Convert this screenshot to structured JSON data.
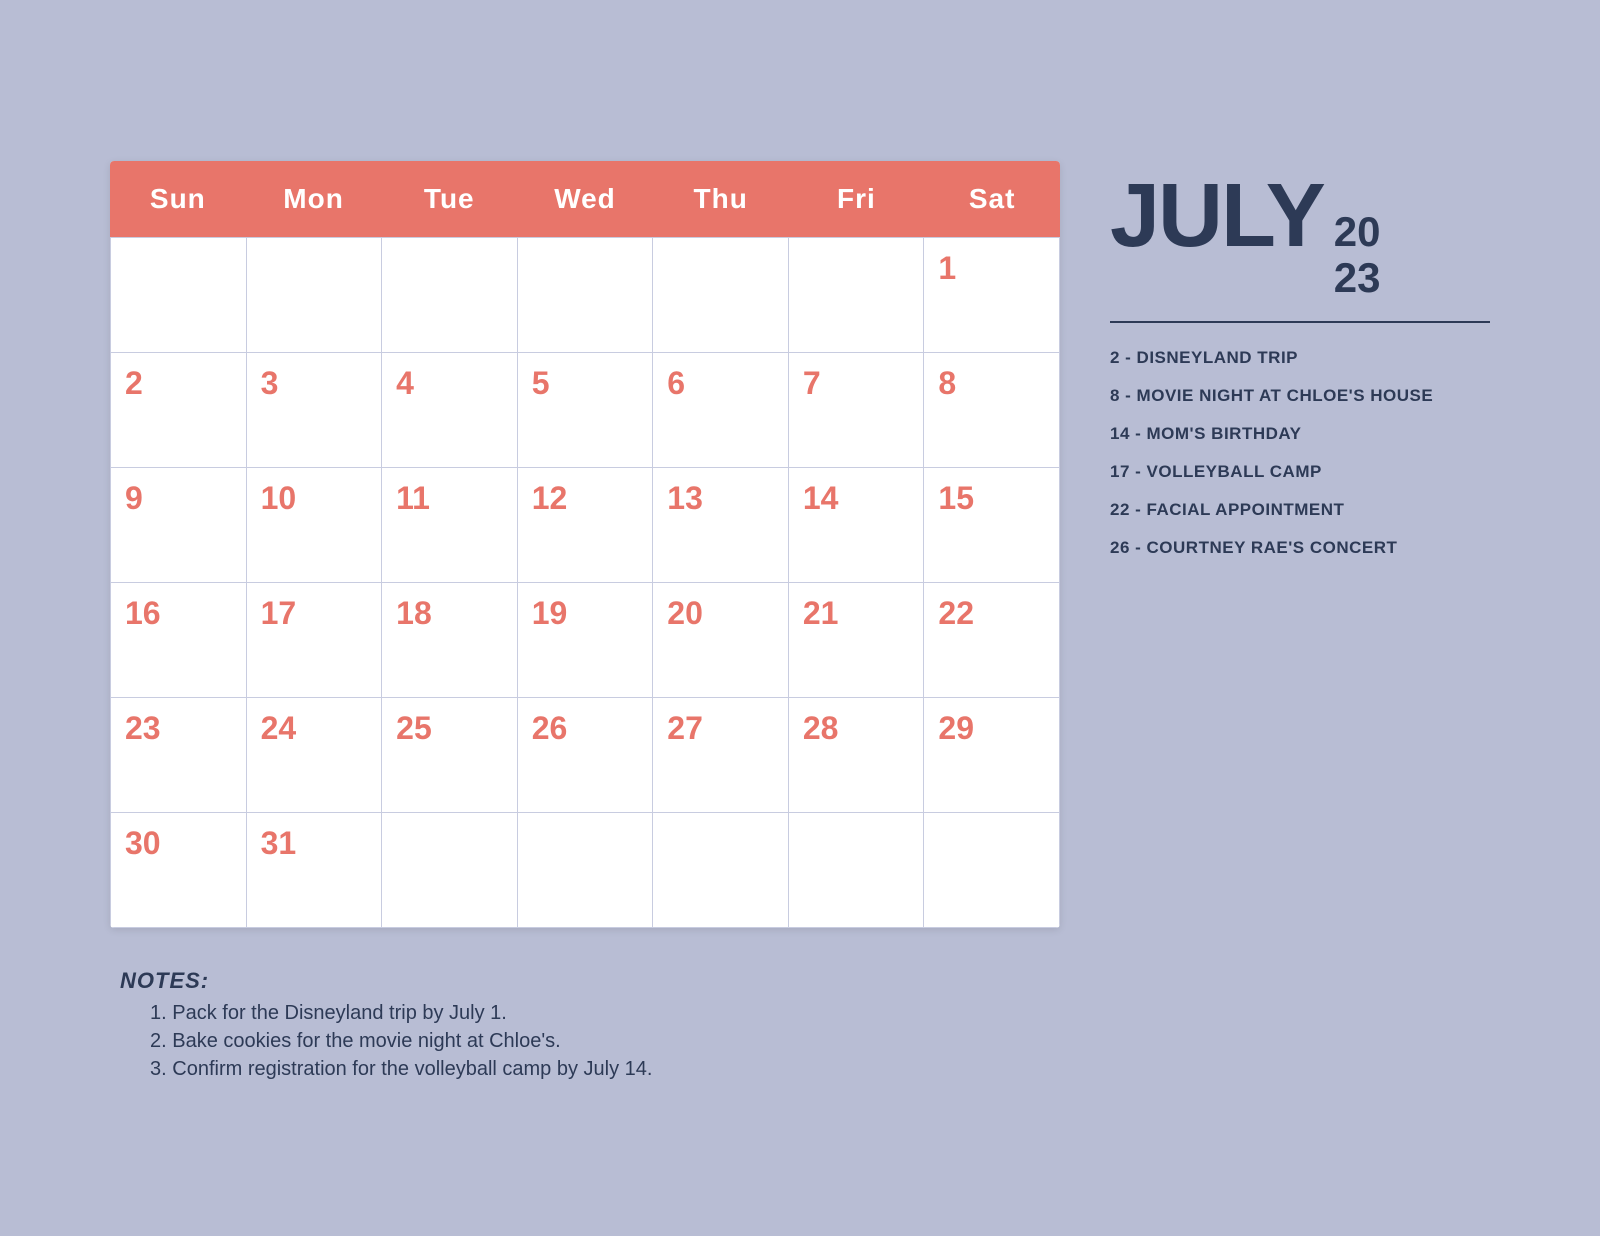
{
  "header": {
    "month": "JULY",
    "year_top": "20",
    "year_bottom": "23"
  },
  "days": {
    "names": [
      "Sun",
      "Mon",
      "Tue",
      "Wed",
      "Thu",
      "Fri",
      "Sat"
    ]
  },
  "calendar": {
    "weeks": [
      [
        {
          "date": "",
          "empty": true
        },
        {
          "date": "",
          "empty": true
        },
        {
          "date": "",
          "empty": true
        },
        {
          "date": "",
          "empty": true
        },
        {
          "date": "",
          "empty": true
        },
        {
          "date": "",
          "empty": true
        },
        {
          "date": "1",
          "empty": false
        }
      ],
      [
        {
          "date": "2",
          "empty": false
        },
        {
          "date": "3",
          "empty": false
        },
        {
          "date": "4",
          "empty": false
        },
        {
          "date": "5",
          "empty": false
        },
        {
          "date": "6",
          "empty": false
        },
        {
          "date": "7",
          "empty": false
        },
        {
          "date": "8",
          "empty": false
        }
      ],
      [
        {
          "date": "9",
          "empty": false
        },
        {
          "date": "10",
          "empty": false
        },
        {
          "date": "11",
          "empty": false
        },
        {
          "date": "12",
          "empty": false
        },
        {
          "date": "13",
          "empty": false
        },
        {
          "date": "14",
          "empty": false
        },
        {
          "date": "15",
          "empty": false
        }
      ],
      [
        {
          "date": "16",
          "empty": false
        },
        {
          "date": "17",
          "empty": false
        },
        {
          "date": "18",
          "empty": false
        },
        {
          "date": "19",
          "empty": false
        },
        {
          "date": "20",
          "empty": false
        },
        {
          "date": "21",
          "empty": false
        },
        {
          "date": "22",
          "empty": false
        }
      ],
      [
        {
          "date": "23",
          "empty": false
        },
        {
          "date": "24",
          "empty": false
        },
        {
          "date": "25",
          "empty": false
        },
        {
          "date": "26",
          "empty": false
        },
        {
          "date": "27",
          "empty": false
        },
        {
          "date": "28",
          "empty": false
        },
        {
          "date": "29",
          "empty": false
        }
      ],
      [
        {
          "date": "30",
          "empty": false
        },
        {
          "date": "31",
          "empty": false
        },
        {
          "date": "",
          "empty": true
        },
        {
          "date": "",
          "empty": true
        },
        {
          "date": "",
          "empty": true
        },
        {
          "date": "",
          "empty": true
        },
        {
          "date": "",
          "empty": true
        }
      ]
    ]
  },
  "events": [
    "2 - DISNEYLAND TRIP",
    "8 - MOVIE NIGHT AT CHLOE'S HOUSE",
    "14 -  MOM'S BIRTHDAY",
    "17 -  VOLLEYBALL CAMP",
    "22 - FACIAL APPOINTMENT",
    "26 - COURTNEY RAE'S CONCERT"
  ],
  "notes": {
    "title": "NOTES:",
    "items": [
      "Pack for the Disneyland trip by July 1.",
      "Bake cookies for the movie night at Chloe's.",
      "Confirm registration for the volleyball camp by July 14."
    ]
  }
}
